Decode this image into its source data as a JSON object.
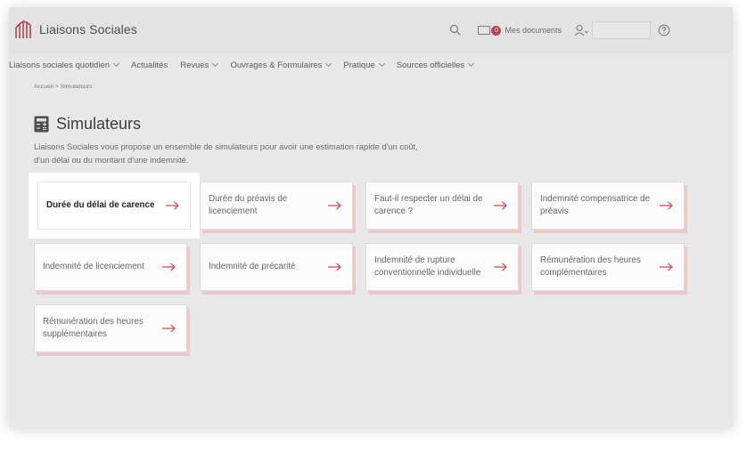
{
  "brand": {
    "name": "Liaisons Sociales"
  },
  "header": {
    "documents_count": "0",
    "documents_label": "Mes documents",
    "icons": [
      "search-icon",
      "folder-icon",
      "user-icon",
      "help-icon"
    ]
  },
  "nav": {
    "items": [
      {
        "label": "Liaisons sociales quotidien",
        "dropdown": true
      },
      {
        "label": "Actualités",
        "dropdown": false
      },
      {
        "label": "Revues",
        "dropdown": true
      },
      {
        "label": "Ouvrages & Formulaires",
        "dropdown": true
      },
      {
        "label": "Pratique",
        "dropdown": true
      },
      {
        "label": "Sources officielles",
        "dropdown": true
      }
    ]
  },
  "breadcrumb": "Accueil > Simulateurs",
  "page": {
    "title": "Simulateurs",
    "intro": "Liaisons Sociales vous propose un ensemble de simulateurs pour avoir une estimation rapide d'un coût, d'un délai ou du montant d'une indemnité."
  },
  "simulators": [
    {
      "label": "Durée du délai de carence",
      "active": true
    },
    {
      "label": "Durée du préavis de licenciement",
      "active": false
    },
    {
      "label": "Faut-il respecter un délai de carence ?",
      "active": false
    },
    {
      "label": "Indemnité compensatrice de préavis",
      "active": false
    },
    {
      "label": "Indemnité de licenciement",
      "active": false
    },
    {
      "label": "Indemnité de précarité",
      "active": false
    },
    {
      "label": "Indemnité de rupture conventionnelle individuelle",
      "active": false
    },
    {
      "label": "Rémunération des heures complémentaires",
      "active": false
    },
    {
      "label": "Rémunération des heures supplémentaires",
      "active": false
    }
  ],
  "colors": {
    "accent": "#c94d58",
    "card_shadow": "#e9c9cc"
  }
}
